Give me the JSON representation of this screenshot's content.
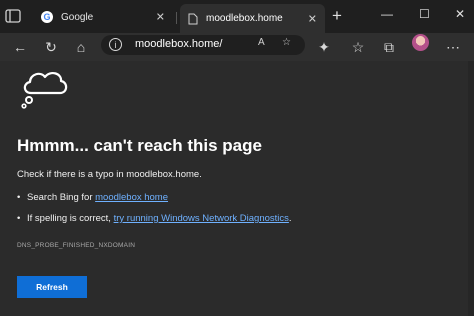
{
  "tabs": [
    {
      "label": "Google"
    },
    {
      "label": "moodlebox.home"
    }
  ],
  "address": {
    "url": "moodlebox.home/"
  },
  "page": {
    "heading": "Hmmm... can't reach this page",
    "check_text": "Check if there is a typo in moodlebox.home.",
    "bullet1_prefix": "Search Bing for ",
    "bullet1_link": "moodlebox home",
    "bullet2_prefix": "If spelling is correct, ",
    "bullet2_link": "try running Windows Network Diagnostics",
    "bullet2_suffix": ".",
    "error_code": "DNS_PROBE_FINISHED_NXDOMAIN",
    "refresh_label": "Refresh"
  },
  "icons": [
    "tab-actions-icon",
    "close-icon",
    "new-tab-icon",
    "minimize-icon",
    "maximize-icon",
    "back-icon",
    "reload-icon",
    "home-icon",
    "info-icon",
    "read-aloud-icon",
    "add-favorite-icon",
    "extensions-icon",
    "favorites-icon",
    "collections-icon",
    "cloud-thought-icon"
  ],
  "colors": {
    "link": "#6fb1ff",
    "refresh_button": "#0f6ed6",
    "background": "#2b2b2b"
  }
}
